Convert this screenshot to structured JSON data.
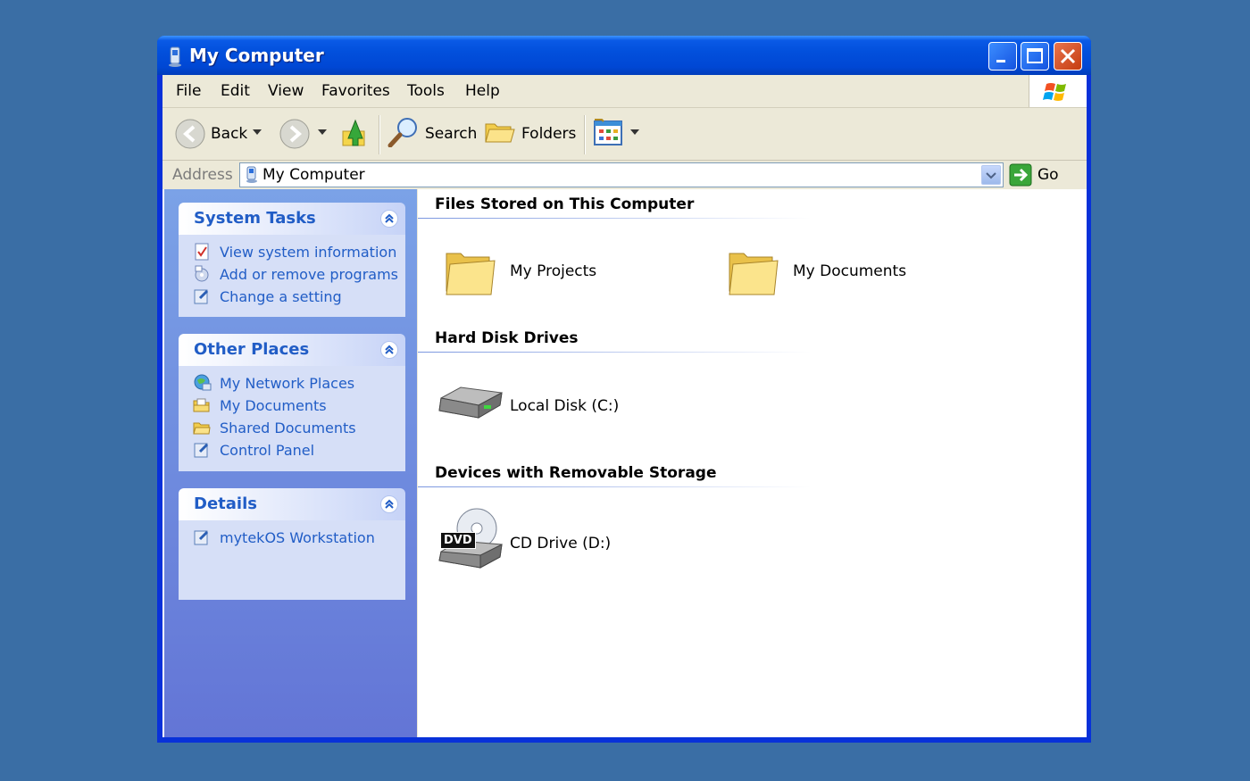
{
  "window": {
    "title": "My Computer",
    "title_icon": "computer-icon"
  },
  "titlebar_buttons": [
    "minimize-icon",
    "maximize-icon",
    "close-icon"
  ],
  "menu": {
    "items": [
      "File",
      "Edit",
      "View",
      "Favorites",
      "Tools",
      "Help"
    ]
  },
  "toolbar": {
    "back_label": "Back",
    "search_label": "Search",
    "folders_label": "Folders"
  },
  "address": {
    "label": "Address",
    "value": "My Computer",
    "go_label": "Go"
  },
  "sidebar": {
    "system_tasks": {
      "title": "System Tasks",
      "items": [
        {
          "label": "View system information",
          "icon": "system-info-icon"
        },
        {
          "label": "Add or remove programs",
          "icon": "add-remove-icon"
        },
        {
          "label": "Change a setting",
          "icon": "control-panel-icon"
        }
      ]
    },
    "other_places": {
      "title": "Other Places",
      "items": [
        {
          "label": "My Network Places",
          "icon": "network-icon"
        },
        {
          "label": "My Documents",
          "icon": "documents-folder-icon"
        },
        {
          "label": "Shared Documents",
          "icon": "folder-icon"
        },
        {
          "label": "Control Panel",
          "icon": "control-panel-icon"
        }
      ]
    },
    "details": {
      "title": "Details",
      "items": [
        {
          "label": "mytekOS Workstation",
          "icon": "control-panel-icon"
        }
      ]
    }
  },
  "content": {
    "groups": [
      {
        "title": "Files Stored on This Computer",
        "items": [
          "My Projects",
          "My Documents"
        ]
      },
      {
        "title": "Hard Disk Drives",
        "items": [
          "Local Disk (C:)"
        ]
      },
      {
        "title": "Devices with Removable Storage",
        "items": [
          "CD Drive (D:)"
        ],
        "badge": "DVD"
      }
    ]
  }
}
